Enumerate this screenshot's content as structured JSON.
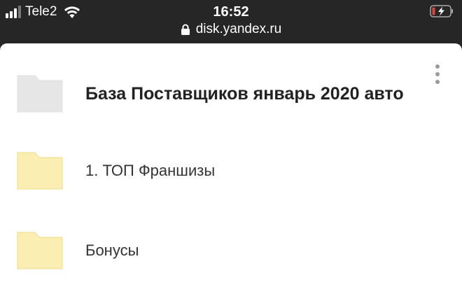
{
  "status_bar": {
    "carrier": "Tele2",
    "time": "16:52",
    "url": "disk.yandex.ru",
    "icons": [
      "signal-icon",
      "wifi-icon",
      "lock-icon",
      "battery-charging-icon"
    ]
  },
  "files": [
    {
      "name": "База Поставщиков январь 2020 авто",
      "type": "folder",
      "color": "#e6e6e6",
      "highlighted": true
    },
    {
      "name": "1. ТОП Франшизы",
      "type": "folder",
      "color": "#fbeeb2",
      "highlighted": false
    },
    {
      "name": "Бонусы",
      "type": "folder",
      "color": "#fbeeb2",
      "highlighted": false
    }
  ],
  "menu": {
    "icon": "more-vertical-icon"
  }
}
